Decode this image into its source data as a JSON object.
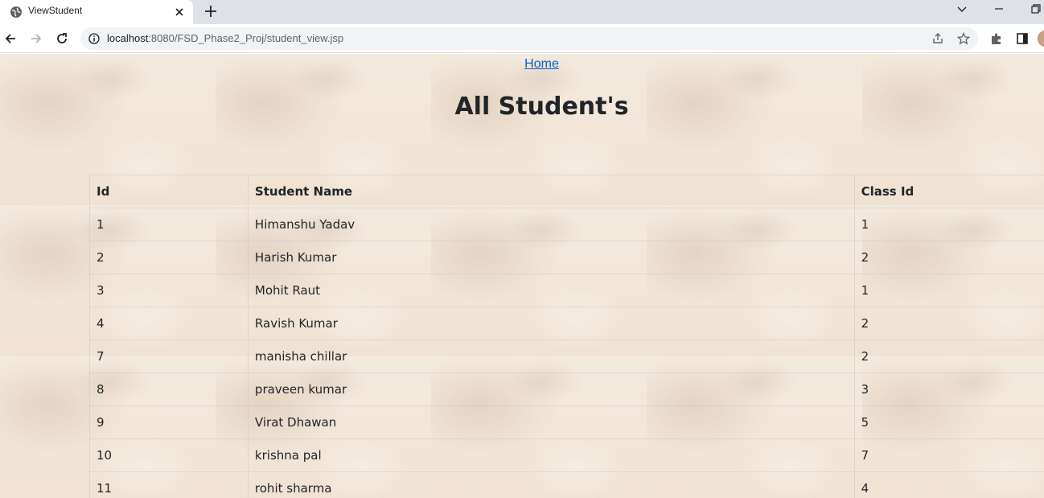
{
  "browser": {
    "tab_title": "ViewStudent",
    "url_host": "localhost",
    "url_rest": ":8080/FSD_Phase2_Proj/student_view.jsp"
  },
  "page": {
    "home_link": "Home",
    "heading": "All Student's"
  },
  "table": {
    "headers": {
      "id": "Id",
      "name": "Student Name",
      "class_id": "Class Id"
    },
    "rows": [
      {
        "id": "1",
        "name": "Himanshu Yadav",
        "class_id": "1"
      },
      {
        "id": "2",
        "name": "Harish Kumar",
        "class_id": "2"
      },
      {
        "id": "3",
        "name": "Mohit Raut",
        "class_id": "1"
      },
      {
        "id": "4",
        "name": "Ravish Kumar",
        "class_id": "2"
      },
      {
        "id": "7",
        "name": "manisha chillar",
        "class_id": "2"
      },
      {
        "id": "8",
        "name": "praveen kumar",
        "class_id": "3"
      },
      {
        "id": "9",
        "name": "Virat Dhawan",
        "class_id": "5"
      },
      {
        "id": "10",
        "name": "krishna pal",
        "class_id": "7"
      },
      {
        "id": "11",
        "name": "rohit sharma",
        "class_id": "4"
      }
    ]
  },
  "icons": {
    "favicon": "globe-icon",
    "tab_close": "close-icon",
    "new_tab": "plus-icon",
    "back": "back-arrow-icon",
    "forward": "forward-arrow-icon",
    "reload": "reload-icon",
    "site_info": "info-icon",
    "share": "share-icon",
    "bookmark": "star-icon",
    "extensions": "puzzle-icon",
    "side_panel": "side-panel-icon"
  },
  "colors": {
    "link": "#0d5fc9",
    "text": "#212529",
    "page_background": "#f1e6d8"
  }
}
